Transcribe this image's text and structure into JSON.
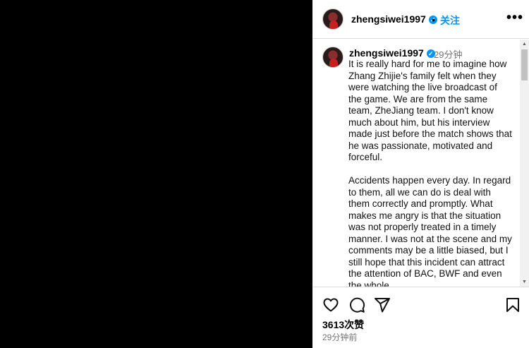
{
  "post": {
    "username": "zhengsiwei1997",
    "follow_label": "关注",
    "separator": "•",
    "more_label": "•••",
    "verified_mark": "✓",
    "comment_time": "29分钟",
    "caption": "It is really hard for me to imagine how Zhang Zhijie's family felt when they were watching the live broadcast of the game. We are from the same team, ZheJiang team. I don't know much about him, but his interview made just before the match shows that he was passionate, motivated and forceful.\n\nAccidents happen every day. In regard to them, all we can do is deal with them correctly and promptly. What makes me angry is that the situation was not properly treated in a timely manner. I was not at the scene and my comments may be a little biased, but I still hope that this incident can attract the attention of BAC, BWF and even the whole",
    "likes": "3613次赞",
    "timestamp": "29分钟前"
  },
  "icons": [
    "heart-icon",
    "comment-icon",
    "share-icon",
    "bookmark-icon",
    "verified-icon"
  ],
  "colors": {
    "accent": "#0095f6",
    "muted": "#737373",
    "border": "#dbdbdb"
  }
}
